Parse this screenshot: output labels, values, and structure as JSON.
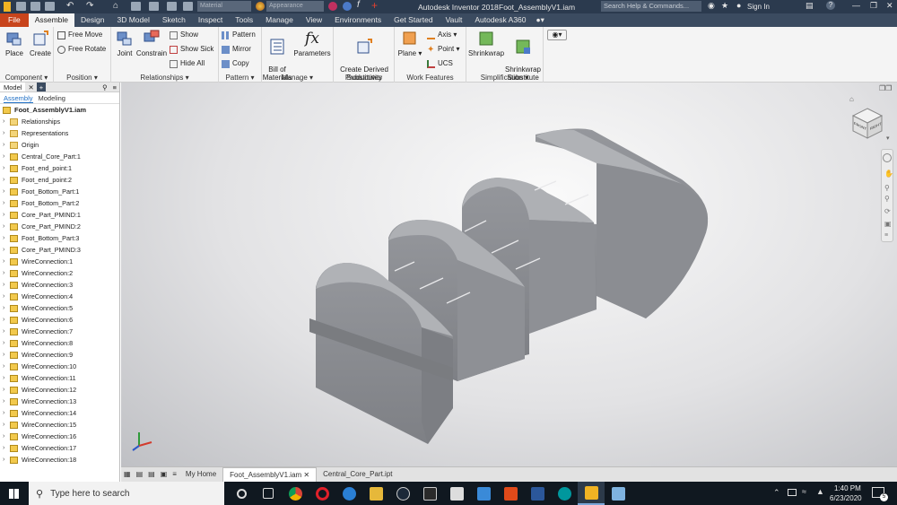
{
  "titlebar": {
    "title": "Autodesk Inventor 2018",
    "document": "Foot_AssemblyV1.iam",
    "material": "Material",
    "appearance": "Appearance",
    "search_placeholder": "Search Help & Commands...",
    "signin": "Sign In",
    "help": "?"
  },
  "menubar": {
    "tabs": [
      "File",
      "Assemble",
      "Design",
      "3D Model",
      "Sketch",
      "Inspect",
      "Tools",
      "Manage",
      "View",
      "Environments",
      "Get Started",
      "Vault",
      "Autodesk A360"
    ],
    "active": "Assemble"
  },
  "ribbon": {
    "component": {
      "label": "Component",
      "place": "Place",
      "create": "Create"
    },
    "position": {
      "label": "Position",
      "free_move": "Free Move",
      "free_rotate": "Free Rotate"
    },
    "relationships": {
      "label": "Relationships",
      "joint": "Joint",
      "constrain": "Constrain",
      "show": "Show",
      "show_sick": "Show Sick",
      "hide_all": "Hide All"
    },
    "pattern": {
      "label": "Pattern",
      "pattern": "Pattern",
      "mirror": "Mirror",
      "copy": "Copy"
    },
    "manage": {
      "label": "Manage",
      "bom": "Bill of\nMaterials",
      "parameters": "Parameters"
    },
    "productivity": {
      "label": "Productivity",
      "derived": "Create Derived\nSubstitutes"
    },
    "workfeatures": {
      "label": "Work Features",
      "plane": "Plane",
      "axis": "Axis",
      "point": "Point",
      "ucs": "UCS"
    },
    "simplification": {
      "label": "Simplification",
      "shrinkwrap": "Shrinkwrap",
      "shrinkwrap_sub": "Shrinkwrap\nSubstitute"
    }
  },
  "browser": {
    "tab_model": "Model",
    "mode_assembly": "Assembly",
    "mode_modeling": "Modeling",
    "root": "Foot_AssemblyV1.iam",
    "items": [
      {
        "label": "Relationships",
        "kind": "folder"
      },
      {
        "label": "Representations",
        "kind": "folder"
      },
      {
        "label": "Origin",
        "kind": "folder"
      },
      {
        "label": "Central_Core_Part:1",
        "kind": "part"
      },
      {
        "label": "Foot_end_point:1",
        "kind": "part"
      },
      {
        "label": "Foot_end_point:2",
        "kind": "part"
      },
      {
        "label": "Foot_Bottom_Part:1",
        "kind": "part"
      },
      {
        "label": "Foot_Bottom_Part:2",
        "kind": "part"
      },
      {
        "label": "Core_Part_PMIND:1",
        "kind": "part"
      },
      {
        "label": "Core_Part_PMIND:2",
        "kind": "part"
      },
      {
        "label": "Foot_Bottom_Part:3",
        "kind": "part"
      },
      {
        "label": "Core_Part_PMIND:3",
        "kind": "part"
      },
      {
        "label": "WireConnection:1",
        "kind": "part"
      },
      {
        "label": "WireConnection:2",
        "kind": "part"
      },
      {
        "label": "WireConnection:3",
        "kind": "part"
      },
      {
        "label": "WireConnection:4",
        "kind": "part"
      },
      {
        "label": "WireConnection:5",
        "kind": "part"
      },
      {
        "label": "WireConnection:6",
        "kind": "part"
      },
      {
        "label": "WireConnection:7",
        "kind": "part"
      },
      {
        "label": "WireConnection:8",
        "kind": "part"
      },
      {
        "label": "WireConnection:9",
        "kind": "part"
      },
      {
        "label": "WireConnection:10",
        "kind": "part"
      },
      {
        "label": "WireConnection:11",
        "kind": "part"
      },
      {
        "label": "WireConnection:12",
        "kind": "part"
      },
      {
        "label": "WireConnection:13",
        "kind": "part"
      },
      {
        "label": "WireConnection:14",
        "kind": "part"
      },
      {
        "label": "WireConnection:15",
        "kind": "part"
      },
      {
        "label": "WireConnection:16",
        "kind": "part"
      },
      {
        "label": "WireConnection:17",
        "kind": "part"
      },
      {
        "label": "WireConnection:18",
        "kind": "part"
      }
    ]
  },
  "viewcube": {
    "front": "FRONT",
    "right": "RIGHT"
  },
  "doctabs": {
    "home": "My Home",
    "tabs": [
      "Foot_AssemblyV1.iam",
      "Central_Core_Part.ipt"
    ],
    "active": "Foot_AssemblyV1.iam"
  },
  "taskbar": {
    "search_placeholder": "Type here to search",
    "time": "1:40 PM",
    "date": "6/23/2020",
    "notifications": "5"
  },
  "colors": {
    "title": "#2b3a4e",
    "menubar": "#3b4b60",
    "file_tab": "#c8441c",
    "part": "#8f9196"
  }
}
